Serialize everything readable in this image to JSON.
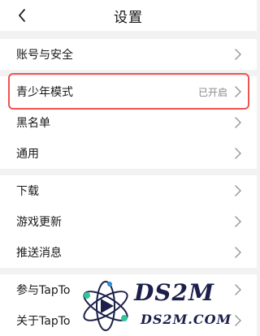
{
  "header": {
    "title": "设置"
  },
  "groups": [
    {
      "items": [
        {
          "label": "账号与安全",
          "status": ""
        }
      ]
    },
    {
      "items": [
        {
          "label": "青少年模式",
          "status": "已开启"
        },
        {
          "label": "黑名单",
          "status": ""
        },
        {
          "label": "通用",
          "status": ""
        }
      ]
    },
    {
      "items": [
        {
          "label": "下载",
          "status": ""
        },
        {
          "label": "游戏更新",
          "status": ""
        },
        {
          "label": "推送消息",
          "status": ""
        }
      ]
    },
    {
      "items": [
        {
          "label": "参与TapTo",
          "status": ""
        },
        {
          "label": "关于TapTo",
          "status": ""
        }
      ]
    }
  ],
  "watermark": {
    "brand": "DS2M",
    "domain": "DS2M.COM"
  },
  "colors": {
    "highlight": "#ef5350",
    "chevron": "#999999",
    "background": "#f2f2f2"
  }
}
